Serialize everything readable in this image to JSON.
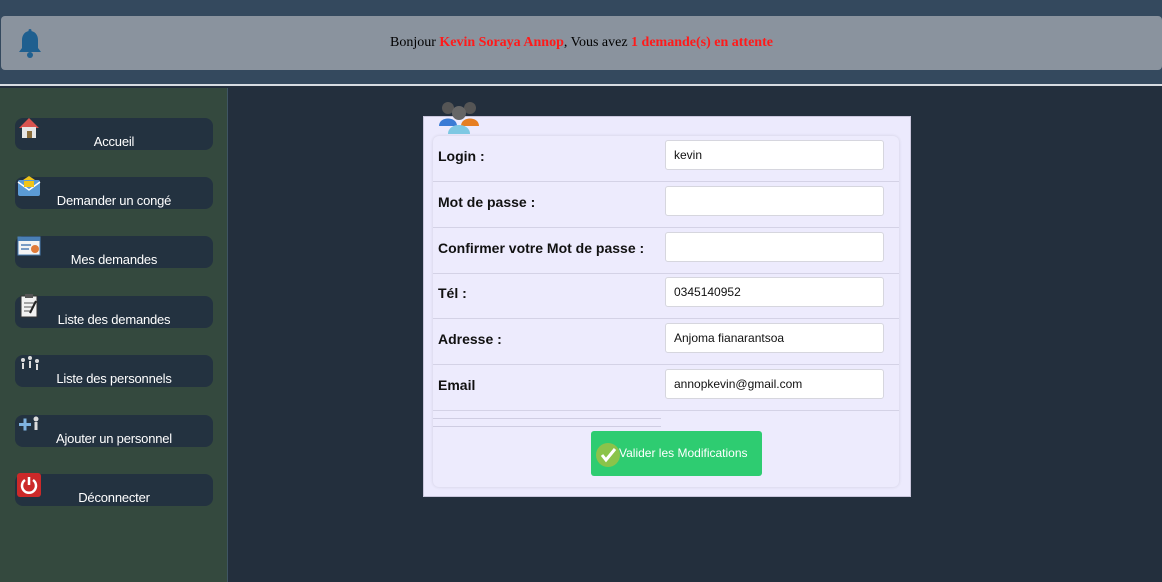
{
  "header": {
    "greeting_prefix": "Bonjour",
    "user_name": "Kevin Soraya Annop",
    "greeting_middle": ", Vous avez",
    "pending_text": "1 demande(s) en attente"
  },
  "sidebar": {
    "items": [
      {
        "label": "Accueil",
        "icon": "home-icon"
      },
      {
        "label": "Demander un congé",
        "icon": "mail-icon"
      },
      {
        "label": "Mes demandes",
        "icon": "profile-card-icon"
      },
      {
        "label": "Liste des demandes",
        "icon": "clipboard-icon"
      },
      {
        "label": "Liste des personnels",
        "icon": "people-icon"
      },
      {
        "label": "Ajouter un personnel",
        "icon": "add-user-icon"
      },
      {
        "label": "Déconnecter",
        "icon": "power-icon"
      }
    ]
  },
  "form": {
    "fields": [
      {
        "label": "Login :",
        "value": "kevin"
      },
      {
        "label": "Mot de passe :",
        "value": ""
      },
      {
        "label": "Confirmer votre Mot de passe :",
        "value": ""
      },
      {
        "label": "Tél :",
        "value": "0345140952"
      },
      {
        "label": "Adresse :",
        "value": "Anjoma fianarantsoa"
      },
      {
        "label": "Email",
        "value": "annopkevin@gmail.com"
      }
    ],
    "submit_label": "Valider les Modifications"
  },
  "colors": {
    "topbar": "#34495e",
    "notification": "#8a939e",
    "highlight": "#ff1a1a",
    "sidebar": "#34493e",
    "nav_item": "#233240",
    "main_bg": "#232f3d",
    "submit": "#2ecc71"
  }
}
